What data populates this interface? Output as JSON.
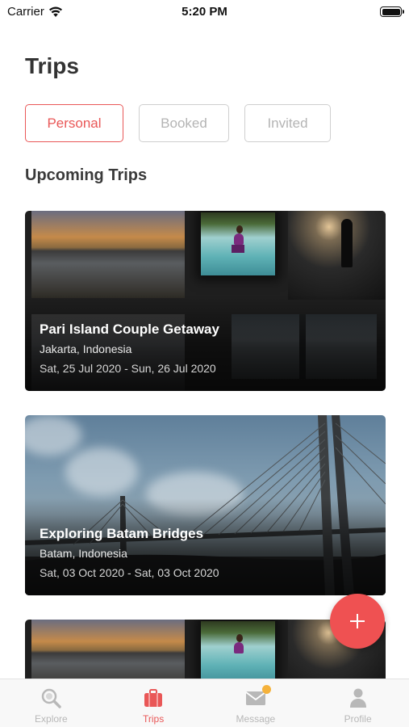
{
  "status_bar": {
    "carrier": "Carrier",
    "time": "5:20 PM"
  },
  "page": {
    "title": "Trips"
  },
  "filters": [
    {
      "label": "Personal",
      "active": true
    },
    {
      "label": "Booked",
      "active": false
    },
    {
      "label": "Invited",
      "active": false
    }
  ],
  "section": {
    "title": "Upcoming Trips"
  },
  "trips": [
    {
      "title": "Pari Island Couple Getaway",
      "location": "Jakarta, Indonesia",
      "dates": "Sat, 25 Jul 2020 - Sun, 26 Jul 2020"
    },
    {
      "title": "Exploring Batam Bridges",
      "location": "Batam, Indonesia",
      "dates": "Sat, 03 Oct 2020 - Sat, 03 Oct 2020"
    }
  ],
  "fab": {
    "icon": "plus-icon"
  },
  "tab_bar": {
    "tabs": [
      {
        "label": "Explore",
        "icon": "search-icon",
        "active": false
      },
      {
        "label": "Trips",
        "icon": "suitcase-icon",
        "active": true
      },
      {
        "label": "Message",
        "icon": "envelope-icon",
        "active": false,
        "badge": true
      },
      {
        "label": "Profile",
        "icon": "person-icon",
        "active": false
      }
    ]
  },
  "colors": {
    "accent": "#e95757",
    "fab": "#ef5152",
    "badge": "#f5b23b",
    "inactive": "#b8b8b8"
  }
}
